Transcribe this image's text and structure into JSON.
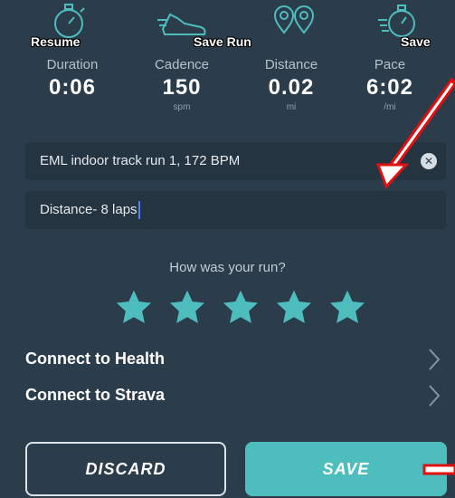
{
  "colors": {
    "background": "#2b3c4b",
    "field": "#243441",
    "accent": "#4dbdbe",
    "annotation": "#e01010"
  },
  "topbar": {
    "actions": [
      {
        "label": "Resume",
        "icon": "stopwatch-icon"
      },
      {
        "label": "Save Run",
        "icon": "running-shoe-icon"
      },
      {
        "label": "",
        "icon": "map-pins-icon"
      },
      {
        "label": "Save",
        "icon": "stopwatch-speed-icon"
      }
    ]
  },
  "stats": [
    {
      "label": "Duration",
      "value": "0:06",
      "unit": ""
    },
    {
      "label": "Cadence",
      "value": "150",
      "unit": "spm"
    },
    {
      "label": "Distance",
      "value": "0.02",
      "unit": "mi"
    },
    {
      "label": "Pace",
      "value": "6:02",
      "unit": "/mi"
    }
  ],
  "form": {
    "title_value": "EML indoor track run 1, 172 BPM",
    "notes_value": "Distance- 8 laps"
  },
  "rating": {
    "question": "How was your run?",
    "stars": 5,
    "max": 5
  },
  "connections": [
    {
      "label": "Connect to Health"
    },
    {
      "label": "Connect to Strava"
    }
  ],
  "buttons": {
    "discard": "DISCARD",
    "save": "SAVE"
  }
}
